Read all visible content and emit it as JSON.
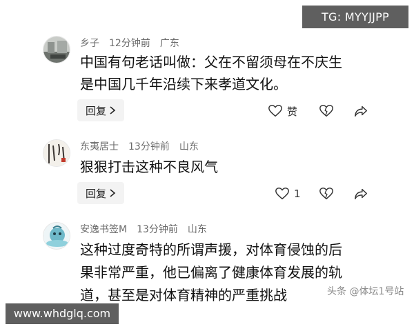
{
  "overlay": {
    "tg_label": "TG: MYYJJPP"
  },
  "comments": [
    {
      "user": "乡子",
      "time": "12分钟前",
      "location": "广东",
      "lines": [
        "中国有句老话叫做：父在不留须母在不庆生",
        "是中国几千年沿续下来孝道文化。"
      ],
      "reply_label": "回复",
      "like_label": "赞"
    },
    {
      "user": "东夷居士",
      "time": "13分钟前",
      "location": "山东",
      "lines": [
        "狠狠打击这种不良风气"
      ],
      "reply_label": "回复",
      "like_label": "1"
    },
    {
      "user": "安逸书签M",
      "time": "13分钟前",
      "location": "山东",
      "lines": [
        "这种过度奇特的所谓声援，对体育侵蚀的后",
        "果非常严重，他已偏离了健康体育发展的轨",
        "道，甚至是对体育精神的严重挑战"
      ]
    }
  ],
  "watermarks": {
    "left": "www.whdglq.com",
    "right": "头条 @体坛1号站"
  },
  "icons": {
    "reply_chevron": "chevron-right-icon",
    "like": "heart-icon",
    "dislike": "broken-heart-icon",
    "share": "share-arrow-icon"
  }
}
